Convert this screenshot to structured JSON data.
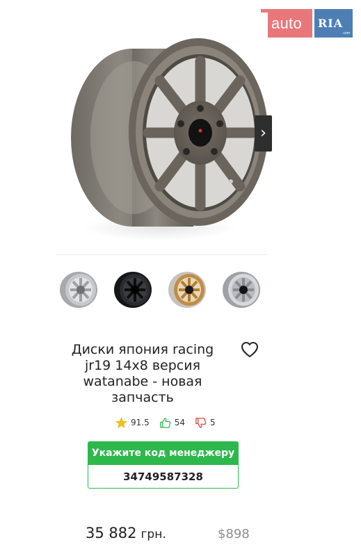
{
  "logo": {
    "left": "auto",
    "right": "RIA",
    "right_sub": ".com"
  },
  "gallery": {
    "next_glyph": "›",
    "thumbnails": [
      {
        "finish": "silver",
        "color": "#b9bbbe"
      },
      {
        "finish": "black",
        "color": "#1e1f22"
      },
      {
        "finish": "gold",
        "color": "#c99a55"
      },
      {
        "finish": "silver-chrome",
        "color": "#a9adb2"
      }
    ]
  },
  "product": {
    "title": "Диски япония racing jr19 14х8 версия watanabe - новая запчасть",
    "favorite_icon": "heart-icon"
  },
  "stats": {
    "rating": "91.5",
    "likes": "54",
    "dislikes": "5"
  },
  "manager": {
    "label": "Укажите код менеджеру",
    "code": "34749587328"
  },
  "price": {
    "uah": "35 882",
    "uah_currency": "грн.",
    "usd": "$898"
  },
  "colors": {
    "accent_green": "#2db84b",
    "logo_red": "#e9777a",
    "logo_blue": "#4d7fb5"
  }
}
